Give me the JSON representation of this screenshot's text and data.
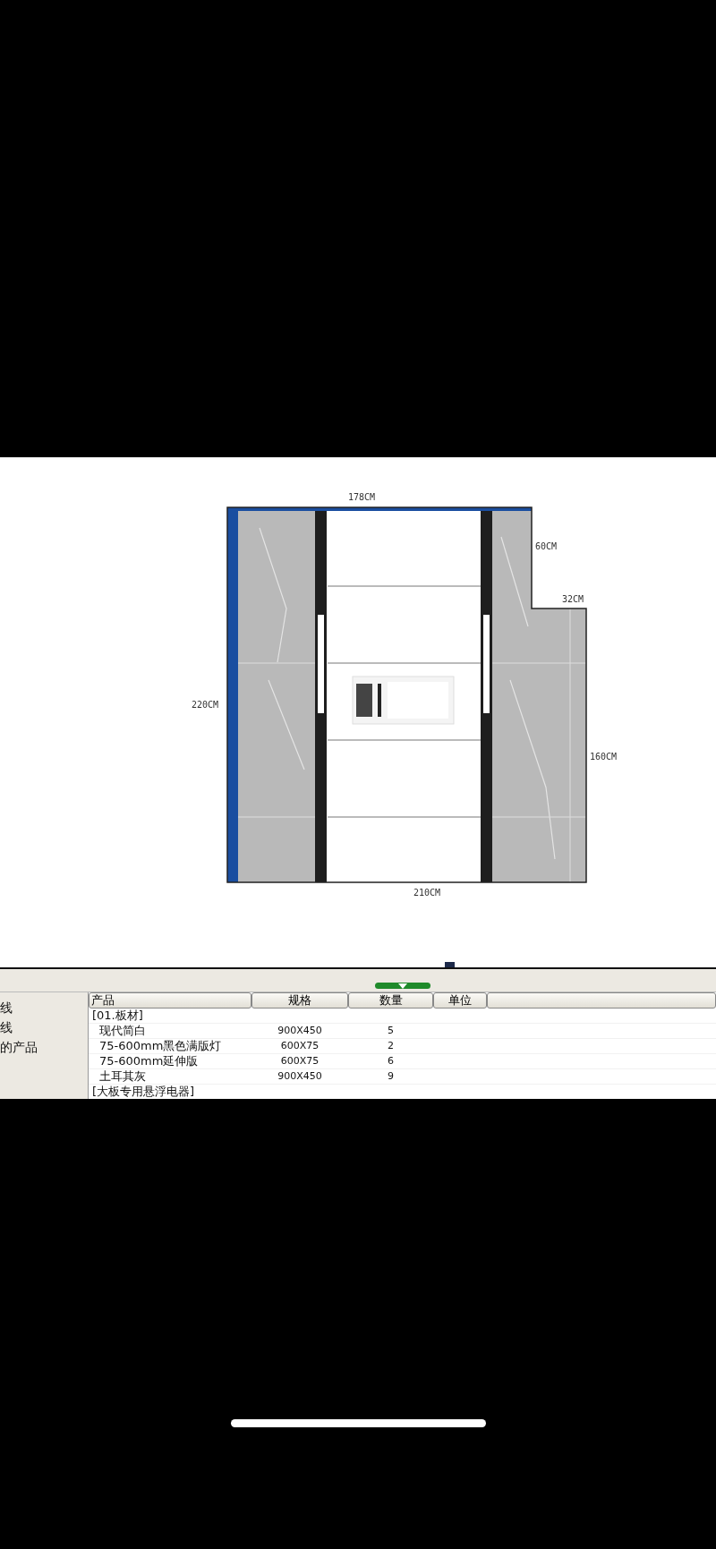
{
  "drawing": {
    "dimensions": {
      "top": "178CM",
      "right_upper": "60CM",
      "step": "32CM",
      "left": "220CM",
      "right_lower": "160CM",
      "bottom": "210CM"
    }
  },
  "sidebar": {
    "items": [
      "线",
      "线",
      "的产品"
    ]
  },
  "table": {
    "columns": [
      "产品",
      "规格",
      "数量",
      "单位"
    ],
    "rows": [
      {
        "kind": "group",
        "product": "[01.板材]"
      },
      {
        "kind": "item",
        "product": "现代简白",
        "spec": "900X450",
        "qty": "5"
      },
      {
        "kind": "item",
        "product": "75-600mm黑色满版灯",
        "spec": "600X75",
        "qty": "2"
      },
      {
        "kind": "item",
        "product": "75-600mm延伸版",
        "spec": "600X75",
        "qty": "6"
      },
      {
        "kind": "item",
        "product": "土耳其灰",
        "spec": "900X450",
        "qty": "9"
      },
      {
        "kind": "group",
        "product": "[大板专用悬浮电器]"
      }
    ]
  }
}
